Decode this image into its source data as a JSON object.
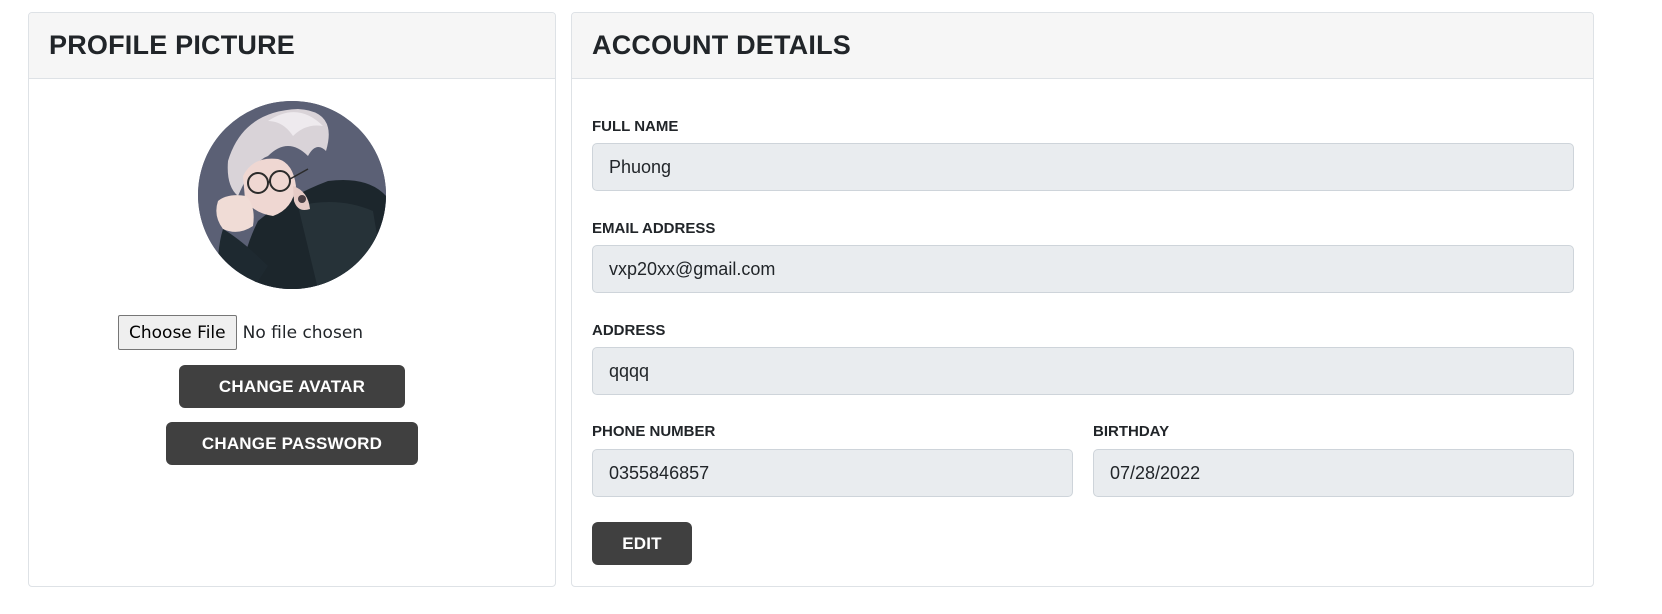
{
  "profile_card": {
    "title": "PROFILE PICTURE",
    "file_input": {
      "button_label": "Choose File",
      "status": "No file chosen"
    },
    "change_avatar_label": "CHANGE AVATAR",
    "change_password_label": "CHANGE PASSWORD"
  },
  "account_card": {
    "title": "ACCOUNT DETAILS",
    "full_name": {
      "label": "FULL NAME",
      "value": "Phuong"
    },
    "email": {
      "label": "EMAIL ADDRESS",
      "value": "vxp20xx@gmail.com"
    },
    "address": {
      "label": "ADDRESS",
      "value": "qqqq"
    },
    "phone": {
      "label": "PHONE NUMBER",
      "value": "0355846857"
    },
    "birthday": {
      "label": "BIRTHDAY",
      "value": "07/28/2022"
    },
    "edit_label": "EDIT"
  },
  "colors": {
    "button_bg": "#404040",
    "input_bg": "#e9ecef",
    "header_bg": "#f6f6f6",
    "border": "#dee2e6"
  }
}
